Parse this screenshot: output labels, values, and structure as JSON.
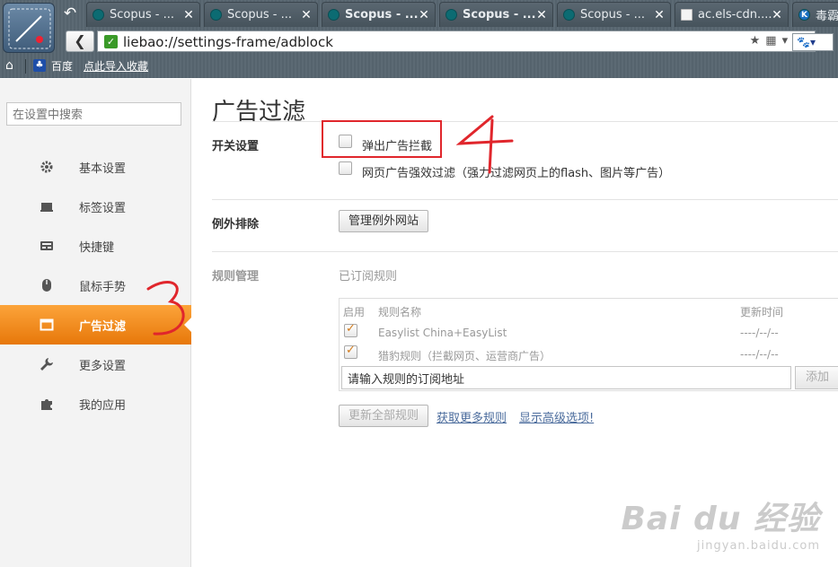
{
  "browser": {
    "tabs": [
      {
        "title": "Scopus - ...",
        "icon": "scopus",
        "bold": false
      },
      {
        "title": "Scopus - ...",
        "icon": "scopus",
        "bold": false
      },
      {
        "title": "Scopus - ...",
        "icon": "scopus",
        "bold": true
      },
      {
        "title": "Scopus - ...",
        "icon": "scopus",
        "bold": true
      },
      {
        "title": "Scopus - ...",
        "icon": "scopus",
        "bold": false
      },
      {
        "title": "ac.els-cdn....",
        "icon": "document",
        "bold": false
      },
      {
        "title": "毒霸",
        "icon": "k-logo",
        "bold": false
      }
    ],
    "url": "liebao://settings-frame/adblock",
    "bookmarks": {
      "baidu": "百度",
      "import": "点此导入收藏"
    }
  },
  "sidebar": {
    "search_placeholder": "在设置中搜索",
    "items": [
      {
        "label": "基本设置",
        "icon": "gear-icon"
      },
      {
        "label": "标签设置",
        "icon": "tab-icon"
      },
      {
        "label": "快捷键",
        "icon": "keyboard-icon"
      },
      {
        "label": "鼠标手势",
        "icon": "mouse-icon"
      },
      {
        "label": "广告过滤",
        "icon": "window-icon",
        "active": true
      },
      {
        "label": "更多设置",
        "icon": "wrench-icon"
      },
      {
        "label": "我的应用",
        "icon": "puzzle-icon"
      }
    ]
  },
  "main": {
    "title": "广告过滤",
    "switch_section": {
      "label": "开关设置",
      "popup_block": "弹出广告拦截",
      "strong_filter": "网页广告强效过滤（强力过滤网页上的flash、图片等广告）"
    },
    "exception_section": {
      "label": "例外排除",
      "button": "管理例外网站"
    },
    "rules_section": {
      "label": "规则管理",
      "subscribed": "已订阅规则",
      "columns": {
        "enabled": "启用",
        "name": "规则名称",
        "updated": "更新时间"
      },
      "rows": [
        {
          "name": "Easylist China+EasyList",
          "updated": "----/--/--",
          "checked": true
        },
        {
          "name": "猎豹规则（拦截网页、运营商广告）",
          "updated": "----/--/--",
          "checked": true
        }
      ],
      "subscribe_value": "请输入规则的订阅地址",
      "add_button": "添加",
      "update_all": "更新全部规则",
      "get_more": "获取更多规则",
      "show_advanced": "显示高级选项!"
    }
  },
  "watermark": {
    "brand": "Bai du 经验",
    "url": "jingyan.baidu.com"
  },
  "colors": {
    "accent": "#f28b1c",
    "annotation": "#e0262c"
  }
}
